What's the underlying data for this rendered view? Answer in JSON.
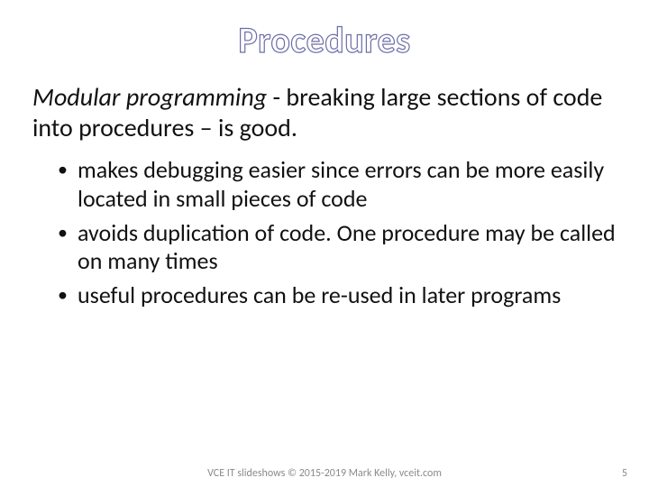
{
  "slide": {
    "title": "Procedures",
    "intro": {
      "emph": "Modular programming",
      "rest": " - breaking large sections of code into procedures – is good."
    },
    "bullets": [
      "makes debugging easier since errors can be more easily located in small pieces of code",
      "avoids duplication of code. One procedure may be called on many times",
      "useful procedures can be re-used in later programs"
    ],
    "footer": {
      "credit": "VCE IT slideshows © 2015-2019 Mark Kelly, vceit.com",
      "page": "5"
    }
  }
}
